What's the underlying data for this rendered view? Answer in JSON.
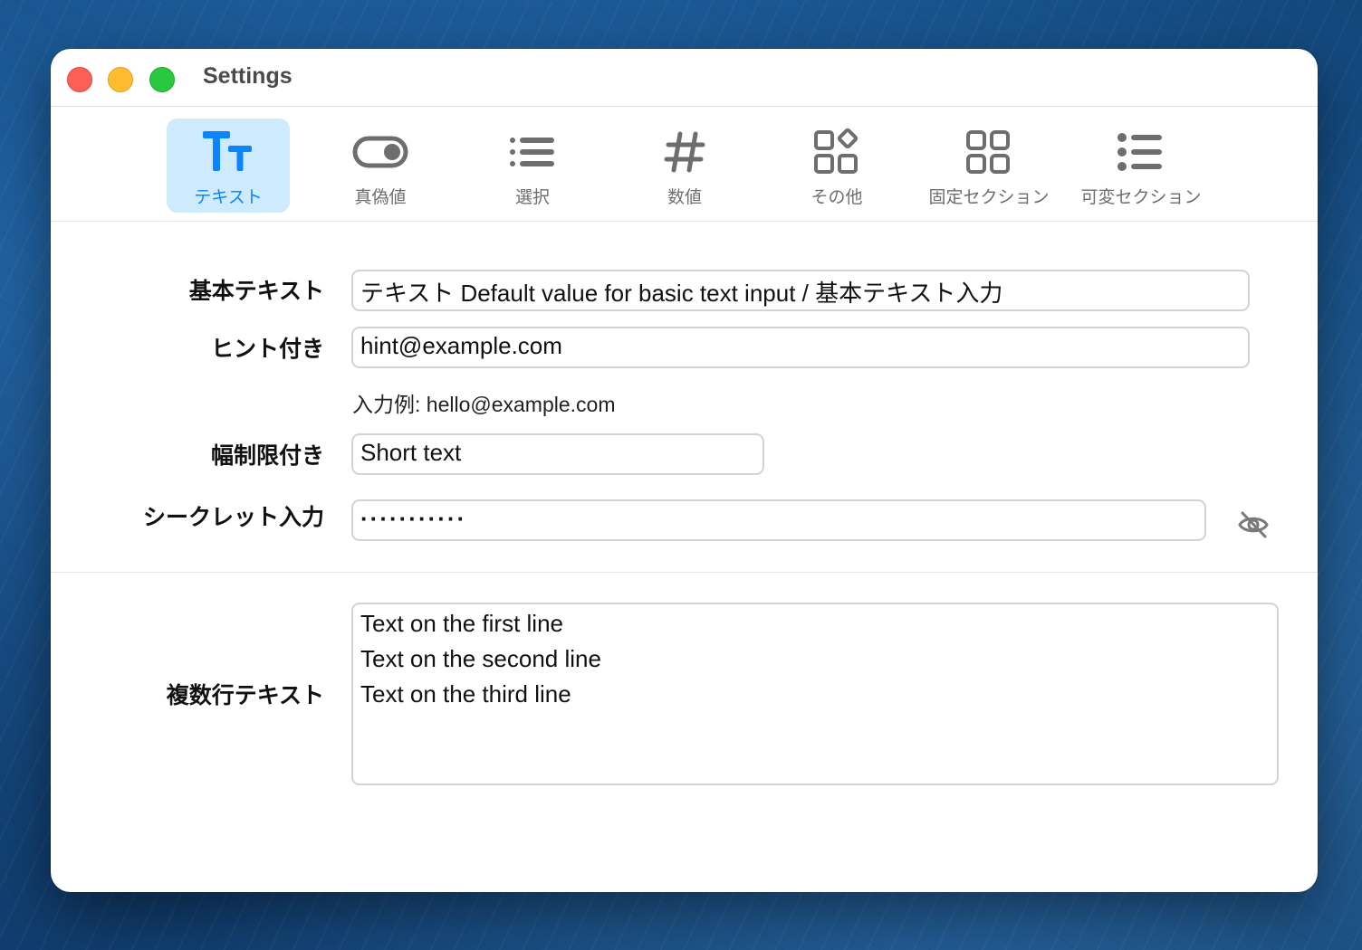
{
  "window": {
    "title": "Settings"
  },
  "tabs": [
    {
      "label": "テキスト",
      "icon": "text-format-icon",
      "active": true
    },
    {
      "label": "真偽値",
      "icon": "toggle-icon",
      "active": false
    },
    {
      "label": "選択",
      "icon": "list-icon",
      "active": false
    },
    {
      "label": "数値",
      "icon": "number-sign-icon",
      "active": false
    },
    {
      "label": "その他",
      "icon": "apps-icon",
      "active": false
    },
    {
      "label": "固定セクション",
      "icon": "grid-icon",
      "active": false
    },
    {
      "label": "可変セクション",
      "icon": "bullet-list-icon",
      "active": false
    }
  ],
  "form": {
    "basic": {
      "label": "基本テキスト",
      "value": "テキスト Default value for basic text input / 基本テキスト入力"
    },
    "hint": {
      "label": "ヒント付き",
      "value": "hint@example.com",
      "hint": "入力例: hello@example.com"
    },
    "width_limited": {
      "label": "幅制限付き",
      "value": "Short text"
    },
    "secret": {
      "label": "シークレット入力",
      "value": "···········",
      "toggle_icon": "eye-slash-icon"
    },
    "multiline": {
      "label": "複数行テキスト",
      "lines": [
        "Text on the first line",
        "Text on the second line",
        "Text on the third line"
      ]
    }
  },
  "colors": {
    "accent": "#0a84ff",
    "active_tab_bg": "#cdebfd"
  }
}
